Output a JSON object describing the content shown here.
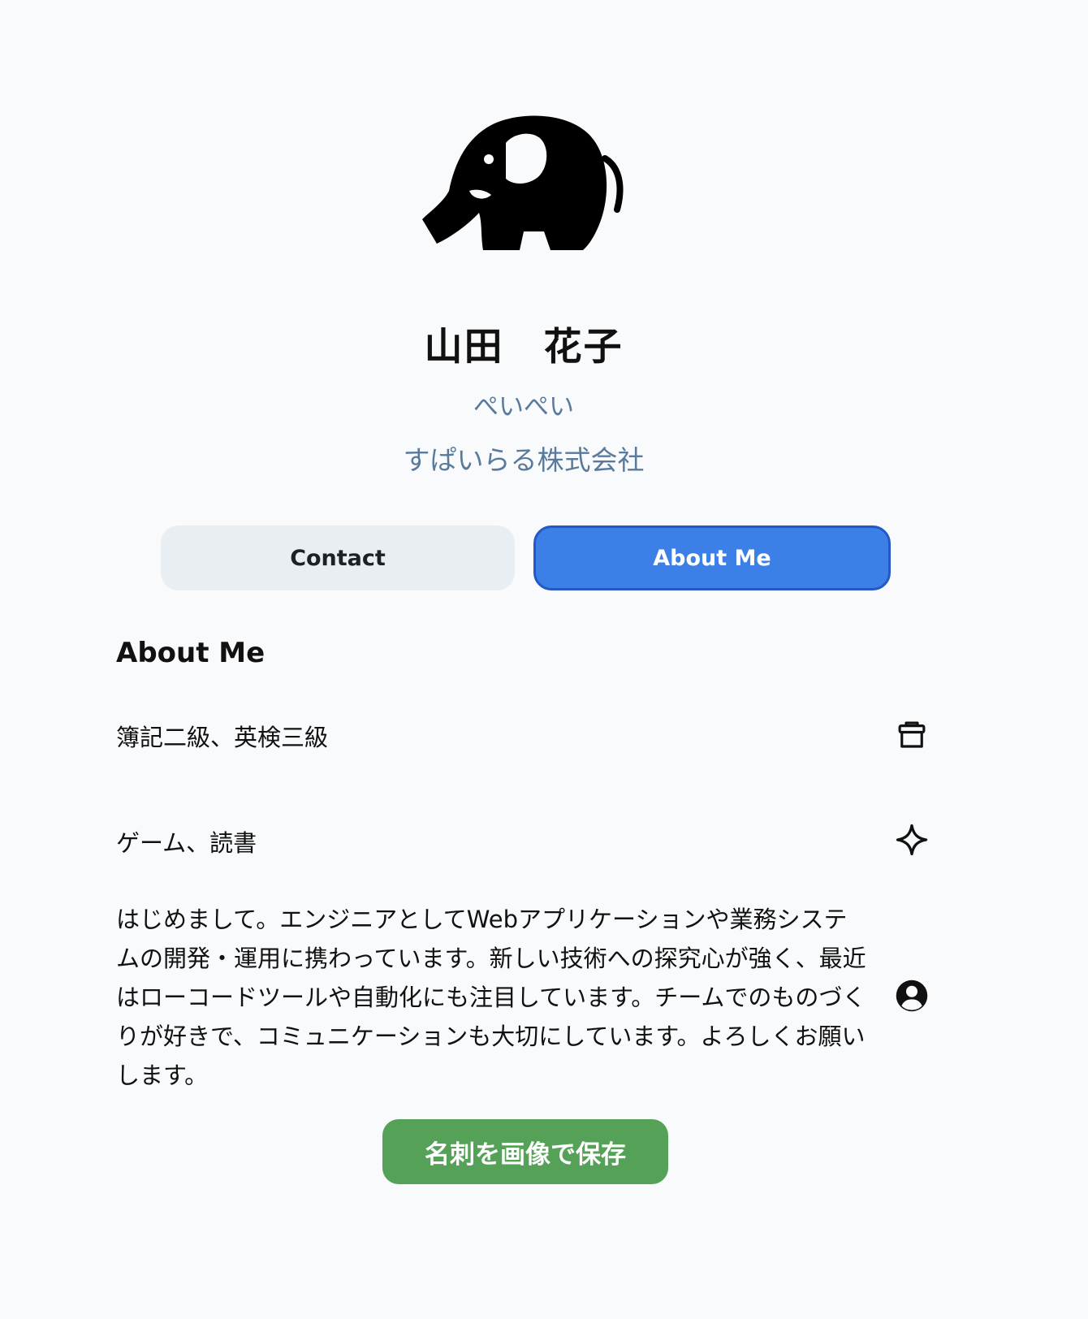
{
  "profile": {
    "name": "山田　花子",
    "nickname": "ぺいぺい",
    "company": "すぱいらる株式会社",
    "logo_icon": "elephant-icon"
  },
  "tabs": {
    "contact_label": "Contact",
    "about_label": "About Me",
    "active": "About Me"
  },
  "about": {
    "title": "About Me",
    "qualifications": "簿記二級、英検三級",
    "qualifications_icon": "toolbox-icon",
    "hobbies": "ゲーム、読書",
    "hobbies_icon": "sparkle-icon",
    "bio": "はじめまして。エンジニアとしてWebアプリケーションや業務システムの開発・運用に携わっています。新しい技術への探究心が強く、最近はローコードツールや自動化にも注目しています。チームでのものづくりが好きで、コミュニケーションも大切にしています。よろしくお願いします。",
    "bio_icon": "user-circle-icon"
  },
  "actions": {
    "save_label": "名刺を画像で保存"
  },
  "colors": {
    "background": "#f8fafc",
    "accent_blue": "#3c7fe7",
    "save_green": "#54a157",
    "subtext": "#5a7a9c"
  }
}
